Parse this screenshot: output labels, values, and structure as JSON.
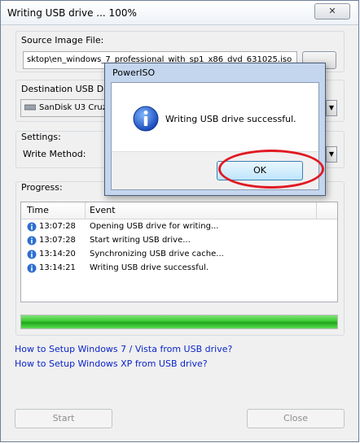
{
  "window": {
    "title": "Writing USB drive ... 100%",
    "close_symbol": "✕"
  },
  "source": {
    "label": "Source Image File:",
    "value": "sktop\\en_windows_7_professional_with_sp1_x86_dvd_631025.iso"
  },
  "destination": {
    "label": "Destination USB Drive",
    "value": "SanDisk U3 Cruze"
  },
  "settings": {
    "label": "Settings:",
    "write_method_label": "Write Method:"
  },
  "progress": {
    "label": "Progress:",
    "columns": [
      "Time",
      "Event"
    ],
    "rows": [
      {
        "time": "13:07:28",
        "event": "Opening USB drive for writing..."
      },
      {
        "time": "13:07:28",
        "event": "Start writing USB drive..."
      },
      {
        "time": "13:14:20",
        "event": "Synchronizing USB drive cache..."
      },
      {
        "time": "13:14:21",
        "event": "Writing USB drive successful."
      }
    ],
    "percent": 100
  },
  "links": [
    "How to Setup Windows 7 / Vista from USB drive?",
    "How to Setup Windows XP from USB drive?"
  ],
  "buttons": {
    "start": "Start",
    "close": "Close"
  },
  "dialog": {
    "title": "PowerISO",
    "message": "Writing USB drive successful.",
    "ok": "OK",
    "icon": "info-icon"
  },
  "colors": {
    "link": "#0b24c9",
    "progress": "#2fbf29",
    "highlight_circle": "#e01a22"
  }
}
